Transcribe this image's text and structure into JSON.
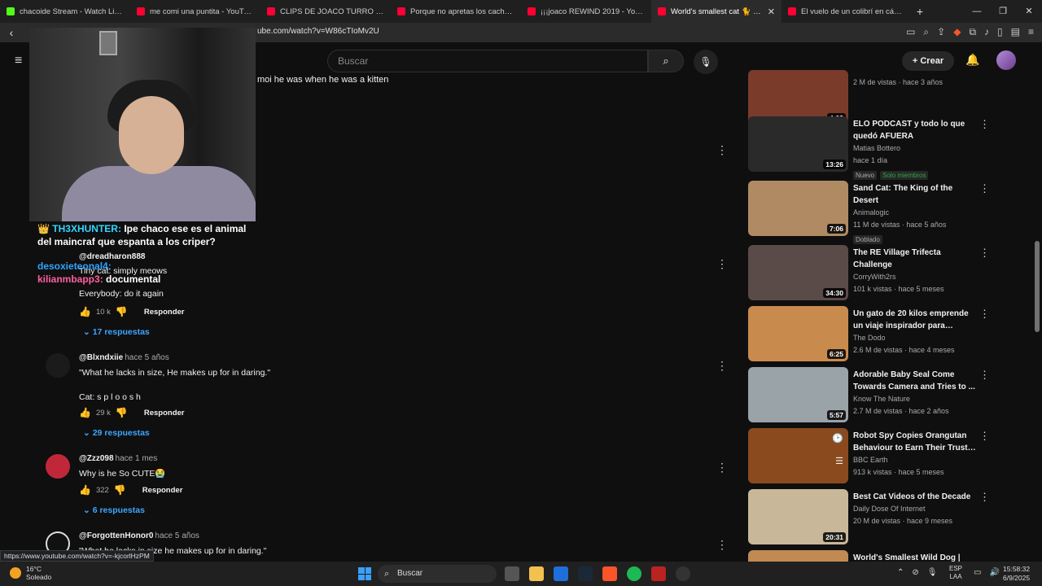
{
  "browser": {
    "tabs": [
      {
        "title": "chacoide Stream - Watch Live on",
        "fav": "k"
      },
      {
        "title": "me comi una puntita - YouTube",
        "fav": "yt"
      },
      {
        "title": "CLIPS DE JOACO TURRO - YouTube",
        "fav": "yt"
      },
      {
        "title": "Porque no apretas los cachetes y me",
        "fav": "yt"
      },
      {
        "title": "¡¡¡joaco REWIND 2019 - YouTube",
        "fav": "yt"
      },
      {
        "title": "World's smallest cat 🐈 - BBC - Y",
        "fav": "yt"
      },
      {
        "title": "El vuelo de un colibrí en cámara lent",
        "fav": "yt"
      }
    ],
    "url": "ube.com/watch?v=W86cTIoMv2U",
    "status_url": "https://www.youtube.com/watch?v=-kjcorlHzPM"
  },
  "yt_header": {
    "search_placeholder": "Buscar",
    "create_label": "Crear"
  },
  "chat": [
    {
      "user": "TH3XHUNTER:",
      "msg": "Ipe chaco ese es el animal del maincraf que espanta a los criper?",
      "color": "#35d3ff"
    },
    {
      "user": "desoxieteonal4:",
      "msg": "",
      "color": "#2fa4ff"
    },
    {
      "user": "kilianmbapp3:",
      "msg": "documental",
      "color": "#ff5fa0"
    }
  ],
  "comments": {
    "top_fragment": "moi he was when he was a kitten",
    "first": {
      "handle": "@dreadharon888",
      "body_line1": "Tiny cat: simply meows",
      "body_line2": "Everybody: do it again",
      "likes": "10 k",
      "reply": "Responder",
      "replies": "17 respuestas"
    },
    "second": {
      "handle": "@Blxndxiie",
      "when": "hace 5 años",
      "body": "\"What he lacks in size, He makes up for in daring.\"\n\nCat: s p l o o s h",
      "likes": "29 k",
      "reply": "Responder",
      "replies": "29 respuestas"
    },
    "third": {
      "handle": "@Zzz098",
      "when": "hace 1 mes",
      "body": "Why is he So CUTE😭",
      "likes": "322",
      "reply": "Responder",
      "replies": "6 respuestas"
    },
    "fourth": {
      "handle": "@ForgottenHonor0",
      "when": "hace 5 años",
      "body": "\"What he lacks in size he makes up for in daring.\""
    }
  },
  "sidebar": [
    {
      "title": "",
      "channel": "",
      "meta": "2 M de vistas · hace 3 años",
      "duration": "4:02",
      "thumb": "#7a3b2a"
    },
    {
      "title": "ELO PODCAST y todo lo que quedó AFUERA",
      "channel": "Matias Bottero",
      "meta": "hace 1 día",
      "duration": "13:26",
      "badge1": "Nuevo",
      "badge2": "Solo miembros",
      "thumb": "#2a2a2a"
    },
    {
      "title": "Sand Cat: The King of the Desert",
      "channel": "Animalogic",
      "meta": "11 M de vistas · hace 5 años",
      "duration": "7:06",
      "badge1": "Doblado",
      "thumb": "#b08a62"
    },
    {
      "title": "The RE Village Trifecta Challenge",
      "channel": "CorryWith2rs",
      "meta": "101 k vistas · hace 5 meses",
      "duration": "34:30",
      "thumb": "#5a4a48"
    },
    {
      "title": "Un gato de 20 kilos emprende un viaje inspirador para perder...",
      "channel": "The Dodo",
      "meta": "2.6 M de vistas · hace 4 meses",
      "duration": "6:25",
      "thumb": "#c98a4e"
    },
    {
      "title": "Adorable Baby Seal Come Towards Camera and Tries to ...",
      "channel": "Know The Nature",
      "meta": "2.7 M de vistas · hace 2 años",
      "duration": "5:57",
      "thumb": "#9aa3a8"
    },
    {
      "title": "Robot Spy Copies Orangutan Behaviour to Earn Their Trust | ...",
      "channel": "BBC Earth",
      "meta": "913 k vistas · hace 5 meses",
      "duration": "",
      "thumb": "#8a4a1e"
    },
    {
      "title": "Best Cat Videos of the Decade",
      "channel": "Daily Dose Of Internet",
      "meta": "20 M de vistas · hace 9 meses",
      "duration": "20:31",
      "thumb": "#c9b79a"
    },
    {
      "title": "World's Smallest Wild Dog |",
      "channel": "",
      "meta": "",
      "duration": "",
      "thumb": "#c08a52"
    }
  ],
  "taskbar": {
    "temp": "16°C",
    "weather": "Soleado",
    "search": "Buscar",
    "lang1": "ESP",
    "lang2": "LAA",
    "time": "15:58:32",
    "date": "6/9/2025"
  }
}
